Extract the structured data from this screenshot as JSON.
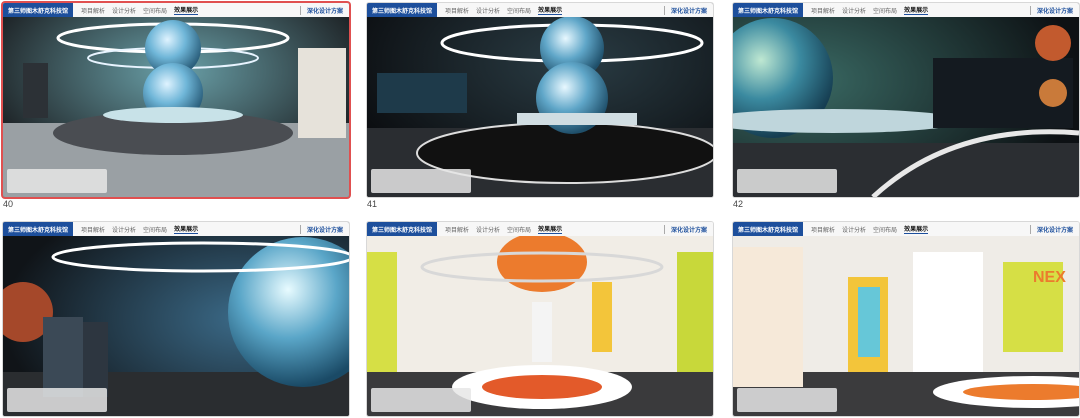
{
  "slides": [
    {
      "number": "40",
      "selected": true
    },
    {
      "number": "41",
      "selected": false
    },
    {
      "number": "42",
      "selected": false
    },
    {
      "number": "",
      "selected": false
    },
    {
      "number": "",
      "selected": false
    },
    {
      "number": "",
      "selected": false
    }
  ],
  "header": {
    "brand": "第三师图木舒克科技馆",
    "nav": [
      "项目解析",
      "设计分析",
      "空间布局",
      "效果展示"
    ],
    "active_nav": "效果展示",
    "scheme": "深化设计方案"
  },
  "colors": {
    "selection": "#e05050",
    "brand": "#1d4f9c"
  }
}
